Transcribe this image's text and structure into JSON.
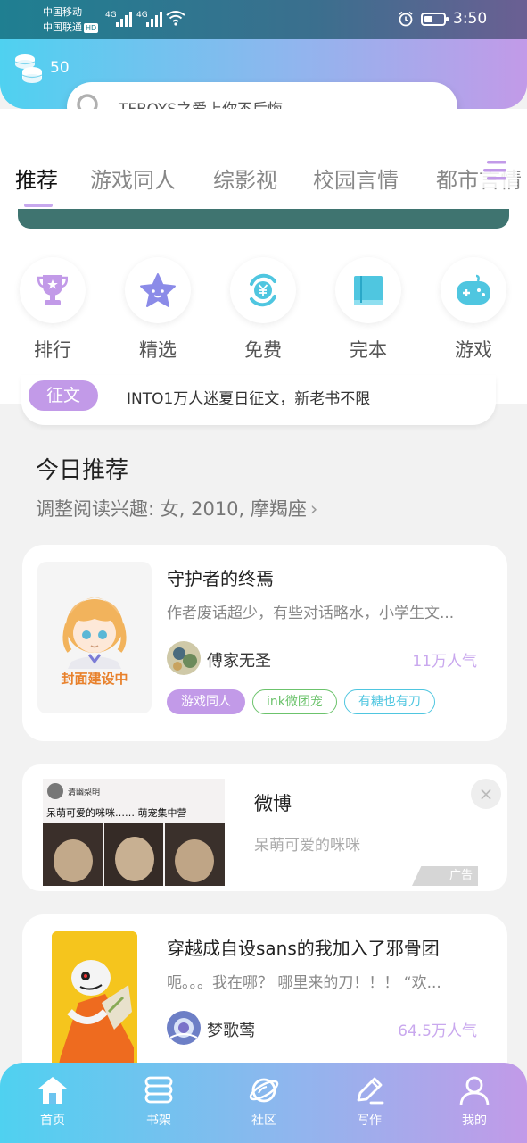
{
  "status_bar": {
    "carrier1": "中国移动",
    "carrier2": "中国联通",
    "hd": "HD",
    "net1": "4G",
    "net2": "4G",
    "time": "3:50"
  },
  "header": {
    "coin_count": "50",
    "search_placeholder": "TFBOYS之爱上你不后悔"
  },
  "tabs": [
    "推荐",
    "游戏同人",
    "综影视",
    "校园言情",
    "都市言情"
  ],
  "categories": [
    {
      "label": "排行",
      "icon": "trophy-icon"
    },
    {
      "label": "精选",
      "icon": "star-icon"
    },
    {
      "label": "免费",
      "icon": "free-yen-icon"
    },
    {
      "label": "完本",
      "icon": "book-icon"
    },
    {
      "label": "游戏",
      "icon": "gamepad-icon"
    }
  ],
  "notice": {
    "tag": "征文",
    "text": "INTO1万人迷夏日征文，新老书不限"
  },
  "section": {
    "title": "今日推荐",
    "subtitle": "调整阅读兴趣: 女, 2010, 摩羯座"
  },
  "books": [
    {
      "title": "守护者的终焉",
      "desc": "作者废话超少，有些对话略水，小学生文...",
      "author": "傅家无圣",
      "popularity": "11万人气",
      "cover_text": "封面建设中",
      "tags": [
        {
          "label": "游戏同人",
          "color": "#c29ae8",
          "style": "filled"
        },
        {
          "label": "ink微团宠",
          "color": "#6cc36c",
          "style": "outline"
        },
        {
          "label": "有糖也有刀",
          "color": "#4fc6e0",
          "style": "outline"
        }
      ]
    },
    {
      "title": "穿越成自设sans的我加入了邪骨团",
      "desc": "呃。。。我在哪？ 哪里来的刀！！！ “欢...",
      "author": "梦歌莺",
      "popularity": "64.5万人气"
    }
  ],
  "ad": {
    "title": "微博",
    "desc": "呆萌可爱的咪咪",
    "label": "广告",
    "img_user": "清幽梨明",
    "img_caption": "呆萌可爱的咪咪…… 萌宠集中营"
  },
  "bottom_nav": [
    {
      "label": "首页",
      "icon": "home-icon"
    },
    {
      "label": "书架",
      "icon": "bookshelf-icon"
    },
    {
      "label": "社区",
      "icon": "planet-icon"
    },
    {
      "label": "写作",
      "icon": "pen-icon"
    },
    {
      "label": "我的",
      "icon": "profile-icon"
    }
  ],
  "colors": {
    "accent_purple": "#c29ae8",
    "accent_cyan": "#4fd1f0",
    "banner_teal": "#3f7470"
  }
}
